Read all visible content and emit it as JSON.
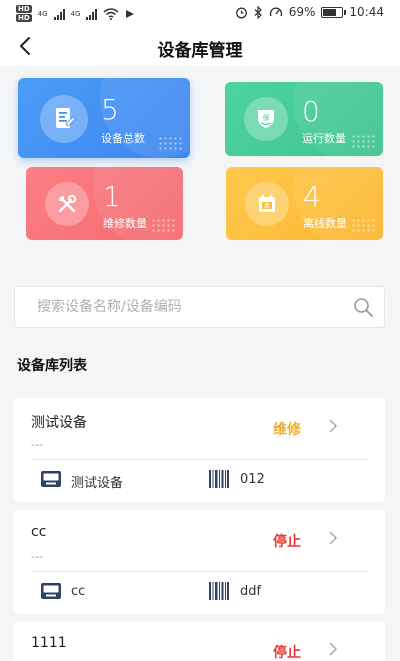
{
  "status_bar": {
    "time": "10:44",
    "battery": "69%",
    "network_labels": [
      "HD",
      "HD"
    ],
    "signal_labels": [
      "4G",
      "4G"
    ]
  },
  "nav": {
    "title": "设备库管理",
    "back_icon": "chevron-left-icon"
  },
  "stats": [
    {
      "value": "5",
      "label": "设备总数",
      "icon": "document-icon",
      "color": "#4390f3"
    },
    {
      "value": "0",
      "label": "运行数量",
      "icon": "shield-hand-icon",
      "color": "#45c998"
    },
    {
      "value": "1",
      "label": "维修数量",
      "icon": "tools-icon",
      "color": "#f8747a"
    },
    {
      "value": "4",
      "label": "离线数量",
      "icon": "calendar-offline-icon",
      "color": "#fcbe3c"
    }
  ],
  "search": {
    "placeholder": "搜索设备名称/设备编码",
    "icon": "search-icon"
  },
  "list_title": "设备库列表",
  "devices": [
    {
      "name": "测试设备",
      "sub": "---",
      "status": "维修",
      "status_color": "#f0ad2e",
      "model": "测试设备",
      "code": "012"
    },
    {
      "name": "cc",
      "sub": "---",
      "status": "停止",
      "status_color": "#e53935",
      "model": "cc",
      "code": "ddf"
    },
    {
      "name": "1111",
      "sub": "",
      "status": "停止",
      "status_color": "#e53935",
      "model": "",
      "code": ""
    }
  ]
}
